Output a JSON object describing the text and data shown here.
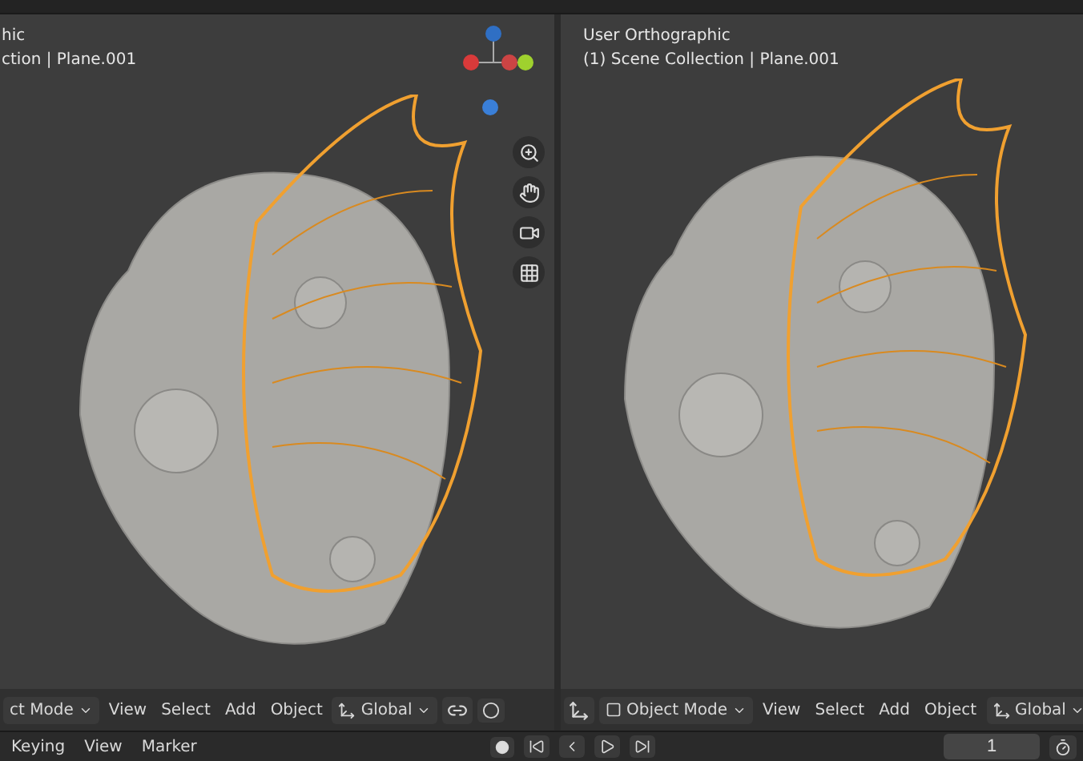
{
  "left_viewport": {
    "view_name": "hic",
    "collection": "ction | Plane.001",
    "header": {
      "mode": "ct Mode",
      "menus": [
        "View",
        "Select",
        "Add",
        "Object"
      ],
      "orientation": "Global"
    }
  },
  "right_viewport": {
    "view_name": "User Orthographic",
    "collection": "(1) Scene Collection | Plane.001",
    "header": {
      "mode": "Object Mode",
      "menus": [
        "View",
        "Select",
        "Add",
        "Object"
      ],
      "orientation": "Global"
    }
  },
  "timeline": {
    "menus": [
      "Keying",
      "View",
      "Marker"
    ],
    "frame": "1"
  }
}
